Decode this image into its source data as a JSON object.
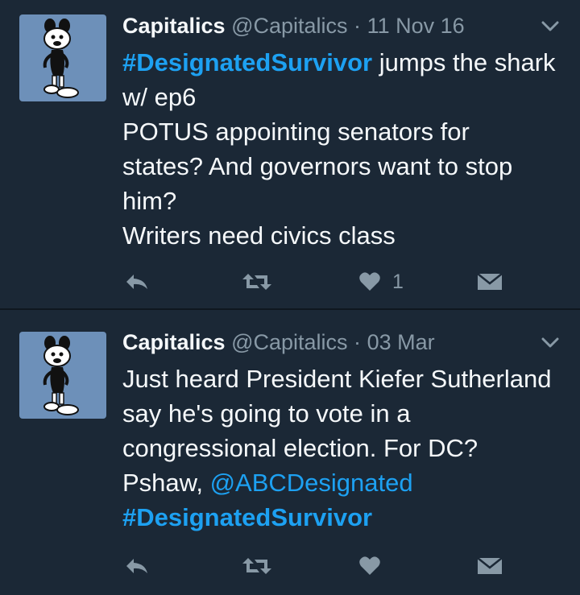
{
  "tweets": [
    {
      "name": "Capitalics",
      "handle": "@Capitalics",
      "separator": "·",
      "time": "11 Nov 16",
      "line1_tag": "#DesignatedSurvivor",
      "line1_rest": " jumps the shark",
      "line2": "w/ ep6",
      "line3": "POTUS appointing senators for",
      "line4": "states? And governors want to stop",
      "line5": "him?",
      "line6": "Writers need civics class",
      "like_count": "1"
    },
    {
      "name": "Capitalics",
      "handle": "@Capitalics",
      "separator": "·",
      "time": "03 Mar",
      "line1": "Just heard President Kiefer Sutherland",
      "line2": "say he's going to vote in a",
      "line3": "congressional election. For DC?",
      "line4_text": "Pshaw, ",
      "line4_mention": "@ABCDesignated",
      "line5_tag": "#DesignatedSurvivor",
      "like_count": ""
    }
  ],
  "colors": {
    "background": "#1b2836",
    "accent": "#1da1f2",
    "muted": "#8899a6",
    "text": "#f5f8fa",
    "avatar_bg": "#6d90b9"
  },
  "icons": [
    "reply-icon",
    "retweet-icon",
    "like-icon",
    "direct-message-icon",
    "chevron-down-icon"
  ]
}
